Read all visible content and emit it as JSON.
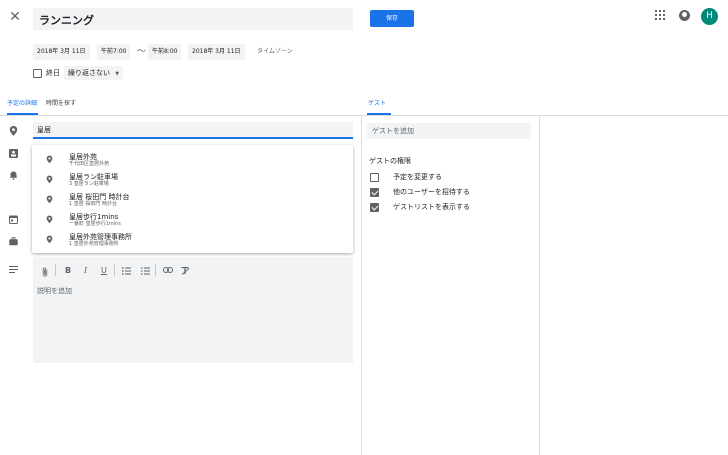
{
  "header": {
    "title": "ランニング",
    "save_label": "保存",
    "avatar_initial": "H"
  },
  "date_row": {
    "start_date": "2018年 3月 11日",
    "start_time": "午前7:00",
    "separator": "〜",
    "end_time": "午前8:00",
    "end_date": "2018年 3月 11日",
    "timezone_label": "タイムゾーン"
  },
  "options": {
    "all_day_label": "終日",
    "all_day_checked": false,
    "repeat_value": "繰り返さない"
  },
  "tabs": {
    "details": "予定の詳細",
    "find_time": "時間を探す",
    "guests": "ゲスト"
  },
  "location": {
    "value": "皇居"
  },
  "suggestions": [
    {
      "title": "皇居外苑",
      "subtitle": "千代田区皇居外苑"
    },
    {
      "title": "皇居ラン駐車場",
      "subtitle": "3 皇居ラン駐車場"
    },
    {
      "title": "皇居 桜田門 時計台",
      "subtitle": "1 皇居 桜田門 時計台"
    },
    {
      "title": "皇居歩行1mins",
      "subtitle": "一番町 皇居歩行1mins"
    },
    {
      "title": "皇居外苑管理事務所",
      "subtitle": "1 皇居外苑管理事務所"
    }
  ],
  "description": {
    "placeholder": "説明を追加"
  },
  "guests": {
    "add_placeholder": "ゲストを追加",
    "permissions_heading": "ゲストの権限",
    "permissions": [
      {
        "label": "予定を変更する",
        "checked": false
      },
      {
        "label": "他のユーザーを招待する",
        "checked": true
      },
      {
        "label": "ゲストリストを表示する",
        "checked": true
      }
    ]
  },
  "colors": {
    "accent": "#1a73e8",
    "avatar_bg": "#00897b",
    "field_bg": "#f1f3f4"
  }
}
